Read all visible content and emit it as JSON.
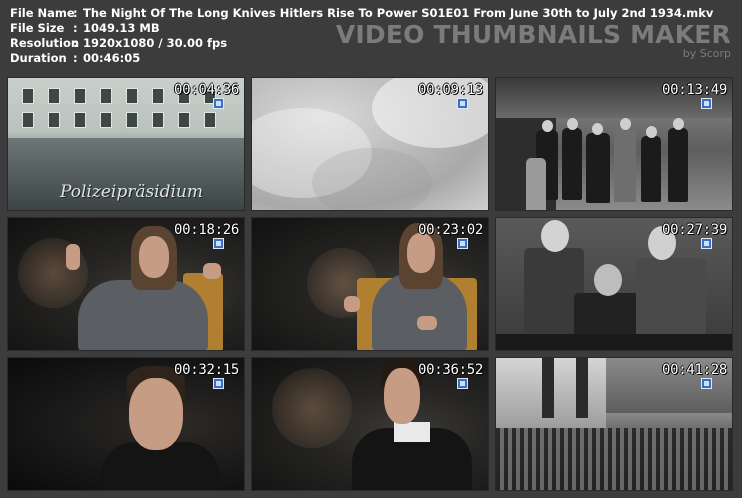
{
  "info": {
    "rows": [
      {
        "label": "File Name",
        "sep": ":",
        "value": "The Night Of The Long Knives Hitlers Rise To Power S01E01 From June 30th to July 2nd 1934.mkv"
      },
      {
        "label": "File Size",
        "sep": ":",
        "value": "1049.13 MB"
      },
      {
        "label": "Resolution",
        "sep": ":",
        "value": "1920x1080 / 30.00 fps"
      },
      {
        "label": "Duration",
        "sep": ":",
        "value": "00:46:05"
      }
    ]
  },
  "brand": {
    "title": "VIDEO THUMBNAILS MAKER",
    "subtitle": "by Scorp"
  },
  "thumbnails": [
    {
      "time": "00:04:36",
      "sign": "Polizeipräsidium"
    },
    {
      "time": "00:09:13"
    },
    {
      "time": "00:13:49"
    },
    {
      "time": "00:18:26"
    },
    {
      "time": "00:23:02"
    },
    {
      "time": "00:27:39"
    },
    {
      "time": "00:32:15"
    },
    {
      "time": "00:36:52"
    },
    {
      "time": "00:41:28"
    }
  ]
}
